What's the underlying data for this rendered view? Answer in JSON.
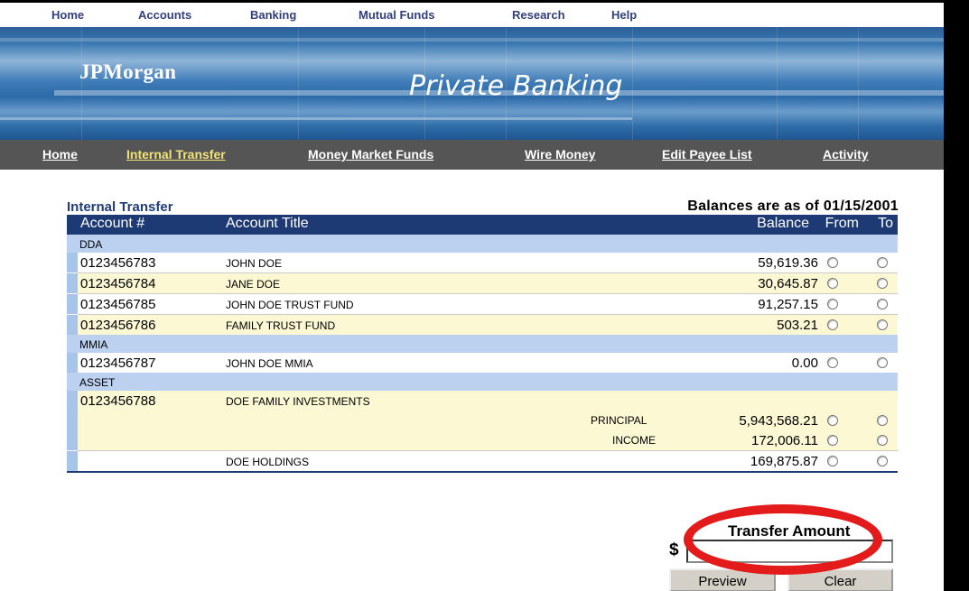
{
  "top_nav": {
    "items": [
      "Home",
      "Accounts",
      "Banking",
      "Mutual Funds",
      "Research",
      "Help"
    ]
  },
  "banner": {
    "logo": "JPMorgan",
    "title": "Private Banking"
  },
  "sub_nav": {
    "items": [
      "Home",
      "Internal Transfer",
      "Money Market Funds",
      "Wire Money",
      "Edit Payee List",
      "Activity"
    ],
    "active": "Internal Transfer"
  },
  "section": {
    "title": "Internal Transfer",
    "balances_as_of": "Balances are as of 01/15/2001"
  },
  "table": {
    "headers": {
      "account": "Account #",
      "title": "Account Title",
      "balance": "Balance",
      "from": "From",
      "to": "To"
    },
    "groups": [
      {
        "name": "DDA",
        "rows": [
          {
            "account": "0123456783",
            "title": "JOHN DOE",
            "balance": "59,619.36"
          },
          {
            "account": "0123456784",
            "title": "JANE DOE",
            "balance": "30,645.87"
          },
          {
            "account": "0123456785",
            "title": "JOHN DOE TRUST FUND",
            "balance": "91,257.15"
          },
          {
            "account": "0123456786",
            "title": "FAMILY TRUST FUND",
            "balance": "503.21"
          }
        ]
      },
      {
        "name": "MMIA",
        "rows": [
          {
            "account": "0123456787",
            "title": "JOHN DOE MMIA",
            "balance": "0.00"
          }
        ]
      },
      {
        "name": "ASSET",
        "rows": [
          {
            "account": "0123456788",
            "title": "DOE FAMILY INVESTMENTS",
            "balance": ""
          },
          {
            "account": "",
            "title": "",
            "sub_label": "PRINCIPAL",
            "balance": "5,943,568.21"
          },
          {
            "account": "",
            "title": "",
            "sub_label": "INCOME",
            "balance": "172,006.11"
          },
          {
            "account": "",
            "title": "DOE HOLDINGS",
            "balance": "169,875.87"
          }
        ]
      }
    ]
  },
  "transfer": {
    "label": "Transfer Amount",
    "currency_symbol": "$",
    "amount_value": "",
    "preview_label": "Preview",
    "clear_label": "Clear"
  },
  "colors": {
    "header_bg": "#1d3a74",
    "group_bg": "#bcd0f0",
    "alt_row_bg": "#fbf8d3",
    "annotation": "#e31b1b"
  }
}
